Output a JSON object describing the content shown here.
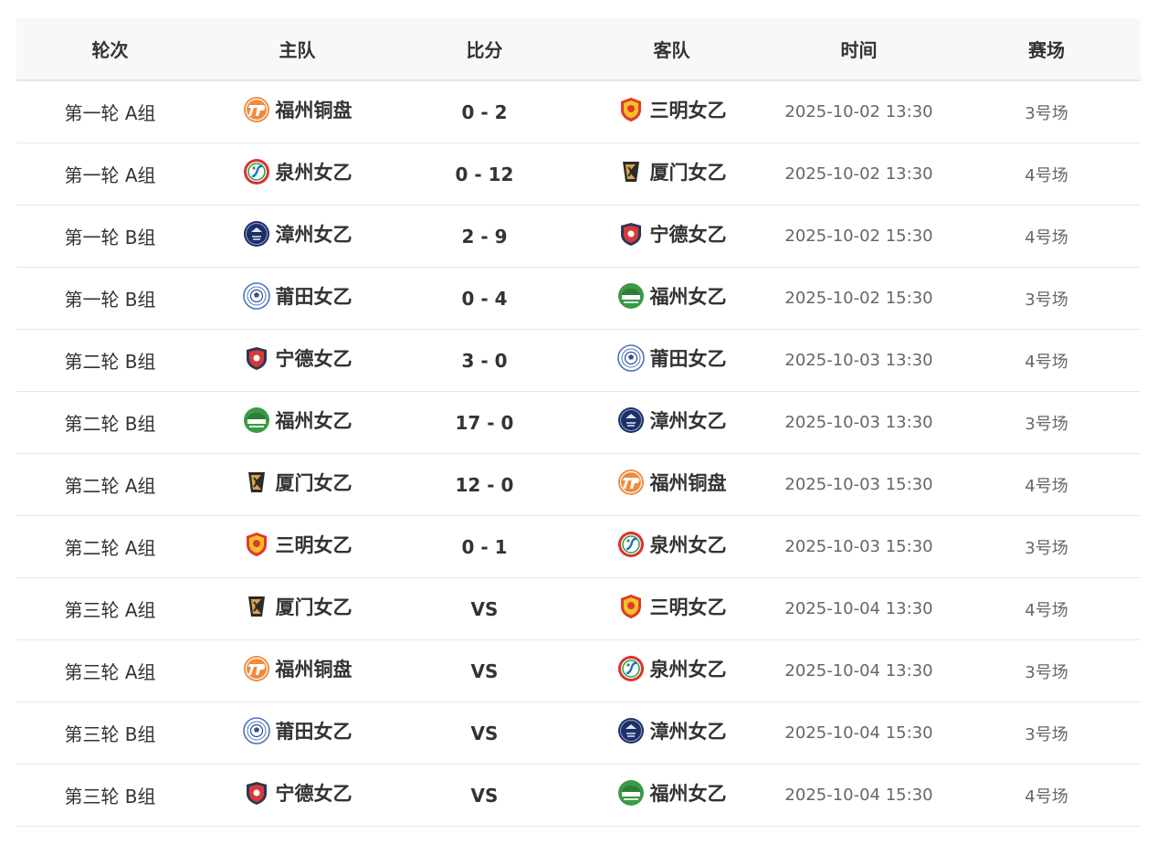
{
  "headers": [
    "轮次",
    "主队",
    "比分",
    "客队",
    "时间",
    "赛场"
  ],
  "matches": [
    {
      "round": "第一轮 A组",
      "home": "福州铜盘",
      "home_icon": "fuzhou-tongpan-logo-icon",
      "score": "0 - 2",
      "away": "三明女乙",
      "away_icon": "sanming-logo-icon",
      "time": "2025-10-02 13:30",
      "venue": "3号场"
    },
    {
      "round": "第一轮 A组",
      "home": "泉州女乙",
      "home_icon": "quanzhou-logo-icon",
      "score": "0 - 12",
      "away": "厦门女乙",
      "away_icon": "xiamen-logo-icon",
      "time": "2025-10-02 13:30",
      "venue": "4号场"
    },
    {
      "round": "第一轮 B组",
      "home": "漳州女乙",
      "home_icon": "zhangzhou-logo-icon",
      "score": "2 - 9",
      "away": "宁德女乙",
      "away_icon": "ningde-logo-icon",
      "time": "2025-10-02 15:30",
      "venue": "4号场"
    },
    {
      "round": "第一轮 B组",
      "home": "莆田女乙",
      "home_icon": "putian-logo-icon",
      "score": "0 - 4",
      "away": "福州女乙",
      "away_icon": "fuzhou-logo-icon",
      "time": "2025-10-02 15:30",
      "venue": "3号场"
    },
    {
      "round": "第二轮 B组",
      "home": "宁德女乙",
      "home_icon": "ningde-logo-icon",
      "score": "3 - 0",
      "away": "莆田女乙",
      "away_icon": "putian-logo-icon",
      "time": "2025-10-03 13:30",
      "venue": "4号场"
    },
    {
      "round": "第二轮 B组",
      "home": "福州女乙",
      "home_icon": "fuzhou-logo-icon",
      "score": "17 - 0",
      "away": "漳州女乙",
      "away_icon": "zhangzhou-logo-icon",
      "time": "2025-10-03 13:30",
      "venue": "3号场"
    },
    {
      "round": "第二轮 A组",
      "home": "厦门女乙",
      "home_icon": "xiamen-logo-icon",
      "score": "12 - 0",
      "away": "福州铜盘",
      "away_icon": "fuzhou-tongpan-logo-icon",
      "time": "2025-10-03 15:30",
      "venue": "4号场"
    },
    {
      "round": "第二轮 A组",
      "home": "三明女乙",
      "home_icon": "sanming-logo-icon",
      "score": "0 - 1",
      "away": "泉州女乙",
      "away_icon": "quanzhou-logo-icon",
      "time": "2025-10-03 15:30",
      "venue": "3号场"
    },
    {
      "round": "第三轮 A组",
      "home": "厦门女乙",
      "home_icon": "xiamen-logo-icon",
      "score": "VS",
      "away": "三明女乙",
      "away_icon": "sanming-logo-icon",
      "time": "2025-10-04 13:30",
      "venue": "4号场"
    },
    {
      "round": "第三轮 A组",
      "home": "福州铜盘",
      "home_icon": "fuzhou-tongpan-logo-icon",
      "score": "VS",
      "away": "泉州女乙",
      "away_icon": "quanzhou-logo-icon",
      "time": "2025-10-04 13:30",
      "venue": "3号场"
    },
    {
      "round": "第三轮 B组",
      "home": "莆田女乙",
      "home_icon": "putian-logo-icon",
      "score": "VS",
      "away": "漳州女乙",
      "away_icon": "zhangzhou-logo-icon",
      "time": "2025-10-04 15:30",
      "venue": "3号场"
    },
    {
      "round": "第三轮 B组",
      "home": "宁德女乙",
      "home_icon": "ningde-logo-icon",
      "score": "VS",
      "away": "福州女乙",
      "away_icon": "fuzhou-logo-icon",
      "time": "2025-10-04 15:30",
      "venue": "4号场"
    }
  ]
}
